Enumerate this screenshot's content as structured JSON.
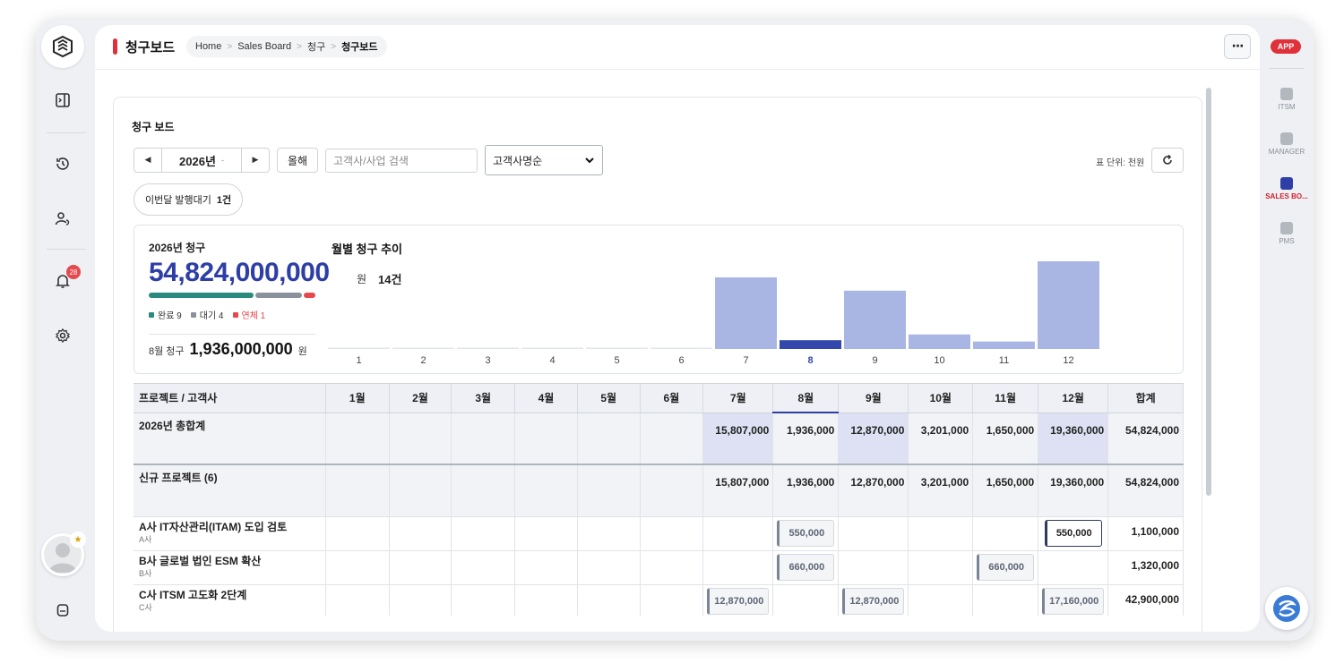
{
  "rightbar": {
    "app_badge": "APP",
    "items": [
      {
        "label": "ITSM",
        "icon": "itsm-icon"
      },
      {
        "label": "MANAGER",
        "icon": "manager-icon"
      },
      {
        "label": "SALES BO...",
        "icon": "sales-board-icon"
      },
      {
        "label": "PMS",
        "icon": "pms-icon"
      }
    ]
  },
  "leftbar": {
    "notification_count": "28",
    "icons": [
      "app-logo-icon",
      "panel-toggle-icon",
      "history-icon",
      "user-sync-icon",
      "bell-icon",
      "gear-icon",
      "bookmark-icon"
    ]
  },
  "header": {
    "title": "청구보드",
    "breadcrumb": [
      "Home",
      "Sales Board",
      "청구",
      "청구보드"
    ]
  },
  "card": {
    "title": "청구 보드",
    "year_label": "2026년",
    "this_year_button": "올해",
    "search_placeholder": "고객사/사업 검색",
    "sort_select": "고객사명순",
    "unit_label": "표 단위: 천원",
    "pending": {
      "label": "이번달 발행대기",
      "count": "1건"
    }
  },
  "summary": {
    "year_title": "2026년 청구",
    "total": "54,824,000,000",
    "won": "원",
    "count": "14건",
    "progress": {
      "done": 9,
      "wait": 4,
      "overdue": 1
    },
    "legend": [
      {
        "label": "완료 9",
        "color": "#2b8a7e"
      },
      {
        "label": "대기 4",
        "color": "#8a919c"
      },
      {
        "label": "연체 1",
        "color": "#e5484d"
      }
    ],
    "month_label": "8월 청구",
    "month_value": "1,936,000,000",
    "month_won": "원",
    "trend_title": "월별 청구 추이"
  },
  "chart_data": {
    "type": "bar",
    "title": "월별 청구 추이",
    "categories": [
      "1",
      "2",
      "3",
      "4",
      "5",
      "6",
      "7",
      "8",
      "9",
      "10",
      "11",
      "12"
    ],
    "values": [
      0,
      0,
      0,
      0,
      0,
      0,
      15807000,
      1936000,
      12870000,
      3201000,
      1650000,
      19360000
    ],
    "highlight_category": "8",
    "colors": {
      "bar": "#a9b6e4",
      "highlight": "#3347ad"
    }
  },
  "table": {
    "headers": [
      "프로젝트 / 고객사",
      "1월",
      "2월",
      "3월",
      "4월",
      "5월",
      "6월",
      "7월",
      "8월",
      "9월",
      "10월",
      "11월",
      "12월",
      "합계"
    ],
    "total_row": {
      "name": "2026년 총합계",
      "cells": [
        "",
        "",
        "",
        "",
        "",
        "",
        "15,807,000",
        "1,936,000",
        "12,870,000",
        "3,201,000",
        "1,650,000",
        "19,360,000",
        "54,824,000"
      ]
    },
    "group_row": {
      "name": "신규 프로젝트 (6)",
      "cells": [
        "",
        "",
        "",
        "",
        "",
        "",
        "15,807,000",
        "1,936,000",
        "12,870,000",
        "3,201,000",
        "1,650,000",
        "19,360,000",
        "54,824,000"
      ]
    },
    "rows": [
      {
        "name": "A사 IT자산관리(ITAM) 도입 검토",
        "client": "A사",
        "cells": [
          "",
          "",
          "",
          "",
          "",
          "",
          "",
          "550,000",
          "",
          "",
          "",
          "550,000",
          "1,100,000"
        ]
      },
      {
        "name": "B사 글로벌 법인 ESM 확산",
        "client": "B사",
        "cells": [
          "",
          "",
          "",
          "",
          "",
          "",
          "",
          "660,000",
          "",
          "",
          "660,000",
          "",
          "1,320,000"
        ]
      },
      {
        "name": "C사 ITSM 고도화 2단계",
        "client": "C사",
        "cells": [
          "",
          "",
          "",
          "",
          "",
          "",
          "12,870,000",
          "",
          "12,870,000",
          "",
          "",
          "17,160,000",
          "42,900,000"
        ]
      }
    ]
  }
}
